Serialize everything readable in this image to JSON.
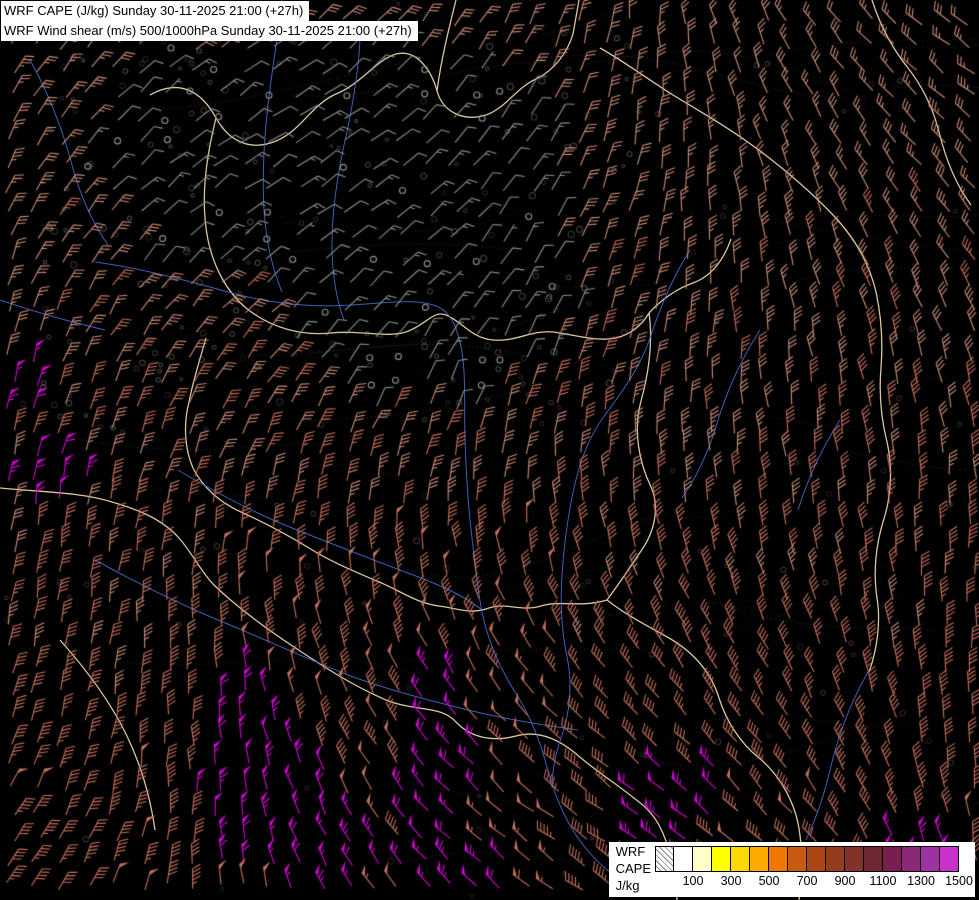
{
  "titles": {
    "line1": "WRF CAPE (J/kg) Sunday 30-11-2025 21:00 (+27h)",
    "line2": "WRF Wind shear (m/s) 500/1000hPa Sunday 30-11-2025 21:00 (+27h)"
  },
  "legend": {
    "title_lines": [
      "WRF",
      "CAPE",
      "J/kg"
    ],
    "ticks": [
      "100",
      "300",
      "500",
      "700",
      "900",
      "1100",
      "1300",
      "1500"
    ],
    "swatches": [
      "hatched",
      "#ffffff",
      "#ffffc8",
      "#ffff00",
      "#ffd800",
      "#ffaa00",
      "#f07800",
      "#c85a14",
      "#aa4614",
      "#963c1e",
      "#823228",
      "#6e2832",
      "#781e50",
      "#8c2878",
      "#a032a0",
      "#c832c8"
    ]
  },
  "map": {
    "background": "#000000",
    "border_color": "#f2ddb0",
    "river_color": "#4a6fd6",
    "barb_colors": {
      "calm": "#8f8f8f",
      "moderate": "#c98b76",
      "strong": "#c4705c",
      "extreme": "#d400d4"
    }
  }
}
